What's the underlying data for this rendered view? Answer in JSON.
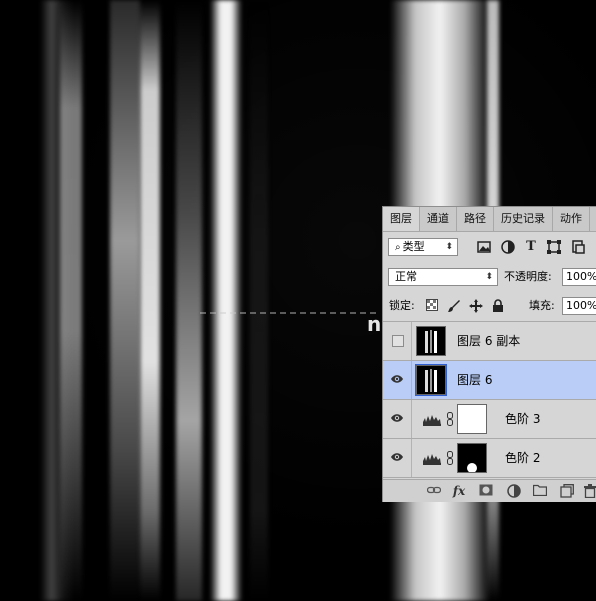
{
  "canvas": {
    "overlay_text": "n"
  },
  "layers_panel": {
    "tabs": [
      {
        "label": "图层",
        "active": true
      },
      {
        "label": "通道",
        "active": false
      },
      {
        "label": "路径",
        "active": false
      },
      {
        "label": "历史记录",
        "active": false
      },
      {
        "label": "动作",
        "active": false
      }
    ],
    "filter": {
      "search_icon": "⌕",
      "selected": "类型",
      "icons": [
        "image-filter-icon",
        "adjustment-filter-icon",
        "type-filter-icon",
        "shape-filter-icon",
        "smart-object-filter-icon"
      ],
      "type_icon_glyph": "T"
    },
    "blend": {
      "mode": "正常",
      "opacity_label": "不透明度:",
      "opacity_value": "100%"
    },
    "lock": {
      "label": "锁定:",
      "fill_label": "填充:",
      "fill_value": "100%"
    },
    "layers": [
      {
        "name": "图层 6 副本",
        "visible": false,
        "selected": false,
        "kind": "pixel"
      },
      {
        "name": "图层 6",
        "visible": true,
        "selected": true,
        "kind": "pixel"
      },
      {
        "name": "色阶 3",
        "visible": true,
        "selected": false,
        "kind": "adjustment",
        "mask": "white"
      },
      {
        "name": "色阶 2",
        "visible": true,
        "selected": false,
        "kind": "adjustment",
        "mask": "black"
      }
    ],
    "bottom_bar": {
      "fx_label": "fx",
      "icons": [
        "link-layers-icon",
        "fx-icon",
        "mask-icon",
        "adjustment-icon",
        "group-icon",
        "new-layer-icon",
        "delete-icon"
      ]
    },
    "colors": {
      "panel_bg": "#d6d6d6",
      "selected_row": "#b9cdf6"
    }
  }
}
